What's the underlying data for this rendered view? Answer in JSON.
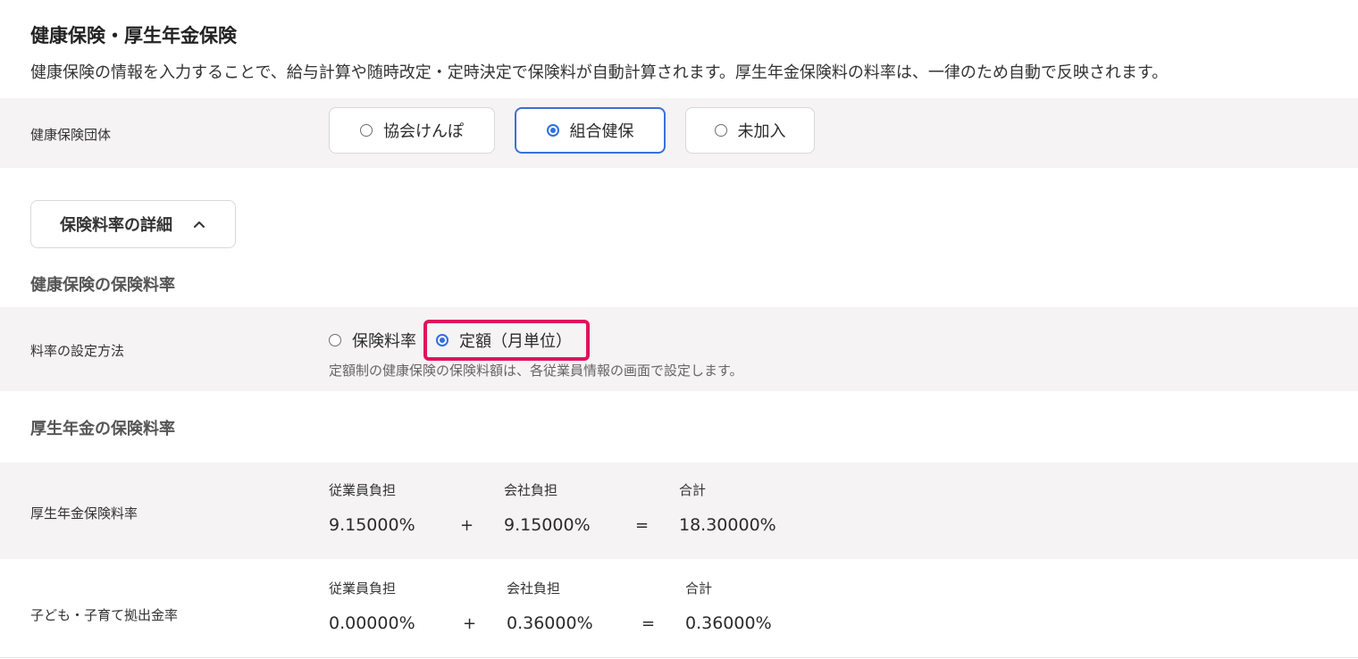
{
  "section": {
    "title": "健康保険・厚生年金保険",
    "description": "健康保険の情報を入力することで、給与計算や随時改定・定時決定で保険料が自動計算されます。厚生年金保険料の料率は、一律のため自動で反映されます。"
  },
  "health_insurance_org": {
    "label": "健康保険団体",
    "options": [
      "協会けんぽ",
      "組合健保",
      "未加入"
    ],
    "selected": "組合健保"
  },
  "details_toggle": {
    "label": "保険料率の詳細"
  },
  "health_rate": {
    "heading": "健康保険の保険料率",
    "method_label": "料率の設定方法",
    "options": [
      "保険料率",
      "定額（月単位）"
    ],
    "selected": "定額（月単位）",
    "note": "定額制の健康保険の保険料額は、各従業員情報の画面で設定します。"
  },
  "pension": {
    "heading": "厚生年金の保険料率",
    "rows": [
      {
        "label": "厚生年金保険料率",
        "employee_head": "従業員負担",
        "employee": "9.15000%",
        "company_head": "会社負担",
        "company": "9.15000%",
        "total_head": "合計",
        "total": "18.30000%"
      },
      {
        "label": "子ども・子育て拠出金率",
        "employee_head": "従業員負担",
        "employee": "0.00000%",
        "company_head": "会社負担",
        "company": "0.36000%",
        "total_head": "合計",
        "total": "0.36000%"
      }
    ],
    "plus": "+",
    "equals": "="
  },
  "colors": {
    "accent": "#2f6fe0",
    "highlight": "#e0125e",
    "row_bg": "#f5f3f4"
  }
}
